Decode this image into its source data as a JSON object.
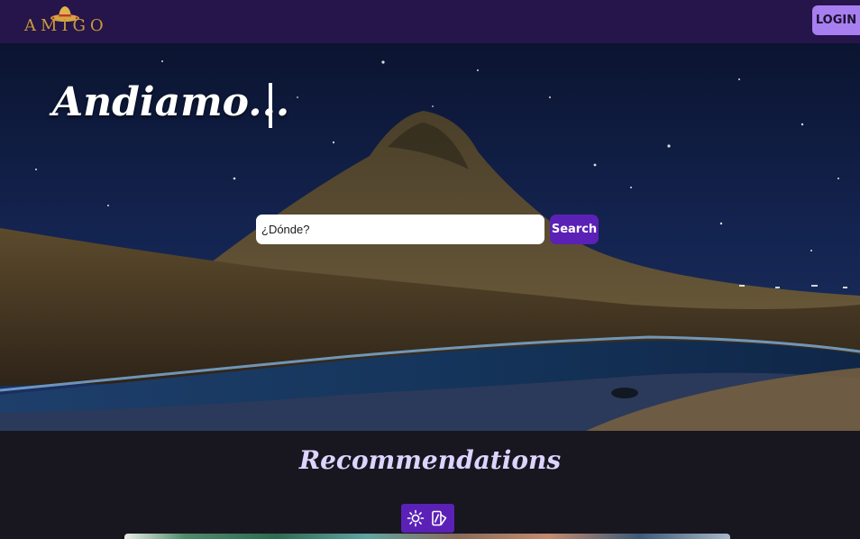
{
  "nav": {
    "logo_text": "AMIGO",
    "login_label": "LOGIN"
  },
  "hero": {
    "title": "Andiamo...",
    "search": {
      "placeholder": "¿Dónde?",
      "button_label": "Search"
    }
  },
  "recommendations": {
    "title": "Recommendations",
    "tools": [
      {
        "icon": "sun-icon"
      },
      {
        "icon": "contrast-icon"
      }
    ]
  },
  "colors": {
    "navbar": "#26154a",
    "login_button": "#a77ff0",
    "accent": "#5b21b6",
    "heading": "#ddd4ff",
    "logo": "#c99a3c",
    "page_background": "#18161f"
  }
}
